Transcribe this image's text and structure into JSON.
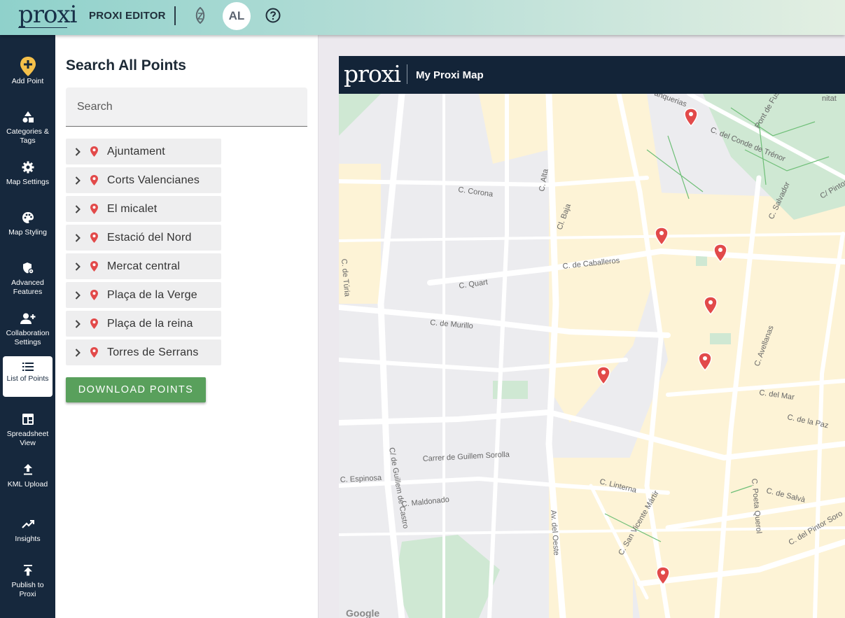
{
  "topbar": {
    "logo": "proxi",
    "editor_label": "PROXI EDITOR",
    "avatar_initials": "AL"
  },
  "nav": [
    {
      "label": "Add Point",
      "icon": "add-location-icon"
    },
    {
      "label": "Categories & Tags",
      "icon": "shapes-icon"
    },
    {
      "label": "Map Settings",
      "icon": "gear-icon"
    },
    {
      "label": "Map Styling",
      "icon": "palette-icon"
    },
    {
      "label": "Advanced Features",
      "icon": "shield-gear-icon"
    },
    {
      "label": "Collaboration Settings",
      "icon": "add-user-icon"
    },
    {
      "label": "List of Points",
      "icon": "list-icon",
      "active": true
    },
    {
      "label": "Spreadsheet View",
      "icon": "table-icon"
    },
    {
      "label": "KML Upload",
      "icon": "upload-icon"
    },
    {
      "label": "Insights",
      "icon": "trending-up-icon"
    },
    {
      "label": "Publish to Proxi",
      "icon": "publish-icon"
    }
  ],
  "panel": {
    "title": "Search All Points",
    "search_placeholder": "Search",
    "points": [
      "Ajuntament",
      "Corts Valencianes",
      "El micalet",
      "Estació del Nord",
      "Mercat central",
      "Plaça de la Verge",
      "Plaça de la reina",
      "Torres de Serrans"
    ],
    "download_label": "DOWNLOAD POINTS"
  },
  "map": {
    "logo": "proxi",
    "title": "My Proxi Map",
    "attribution": "Google",
    "street_labels": [
      "C. Corona",
      "C. Alta",
      "Cl. Baja",
      "C. de Caballeros",
      "C. Quart",
      "C. de Murillo",
      "C. del Conde de Trénor",
      "C. Salvador",
      "C/ Pintor L",
      "Pont de Fus",
      "anquerias",
      "C. Avellanas",
      "C. del Mar",
      "C. de la Paz",
      "Carrer de Guillem Sorolla",
      "C. Espinosa",
      "C. Maldonado",
      "C. Linterna",
      "C. San Vicente Mártir",
      "C. Poeta Querol",
      "C. de Salvà",
      "C. del Pintor Soro",
      "Av. del Oeste",
      "C/ de Guillem de Castro",
      "C. de Túria",
      "nitat"
    ],
    "colors": {
      "water_park": "#cfe8d3",
      "street": "#ffffff",
      "block": "#e9e9ec",
      "highlight_block": "#fdf3d6",
      "pin": "#e24a4a"
    }
  }
}
